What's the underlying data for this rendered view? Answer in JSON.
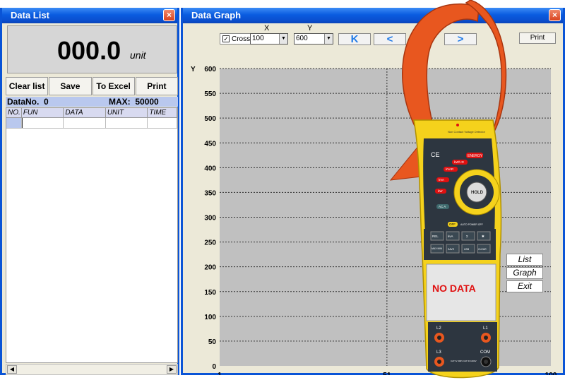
{
  "data_list": {
    "title": "Data List",
    "close_label": "×",
    "display_value": "000.0",
    "display_unit": "unit",
    "buttons": [
      "Clear list",
      "Save",
      "To Excel",
      "Print"
    ],
    "data_no_label": "DataNo.",
    "data_no_value": "0",
    "max_label": "MAX:",
    "max_value": "50000",
    "columns": [
      "NO.",
      "FUN",
      "DATA",
      "UNIT",
      "TIME"
    ]
  },
  "data_graph": {
    "title": "Data Graph",
    "close_label": "×",
    "x_label": "X",
    "y_label": "Y",
    "cross_label": "Cross",
    "cross_checked": "✓",
    "x_select": "100",
    "y_select": "600",
    "nav": [
      "K",
      "<",
      ">"
    ],
    "print_label": "Print",
    "y_axis_title": "Y",
    "x_axis_title": "X",
    "y_ticks": [
      "600",
      "550",
      "500",
      "450",
      "400",
      "350",
      "300",
      "250",
      "200",
      "150",
      "100",
      "50",
      "0"
    ],
    "x_ticks": [
      "1",
      "51",
      "100"
    ]
  },
  "side_buttons": [
    "List",
    "Graph",
    "Exit"
  ],
  "meter": {
    "screen_text": "NO DATA",
    "energy": "ENERGY",
    "modes": [
      "kWh Φ",
      "kVAR",
      "kVA",
      "kW",
      "AC A"
    ],
    "hold": "HOLD",
    "buttons_row1": [
      "REL",
      "kvA",
      "Σ",
      "✱"
    ],
    "buttons_row2": [
      "MAX MIN",
      "SAVE",
      "USB",
      "CLEAR"
    ],
    "auto_off": "AUTO POWER OFF",
    "off": "OFF",
    "jack_labels": [
      "L2",
      "L1",
      "L3",
      "COM"
    ],
    "ce": "CE",
    "ncv": "Non Contact Voltage Detector",
    "cat": "CAT IV 600V CAT III 1000V"
  },
  "colors": {
    "title_blue": "#0a5ce0",
    "plot_bg": "#c0c0c0",
    "meter_yellow": "#f5d21c",
    "meter_orange": "#e8571f",
    "no_data_red": "#e01010"
  },
  "chart_data": {
    "type": "line",
    "series": [],
    "x_ticks": [
      1,
      51,
      100
    ],
    "y_ticks": [
      0,
      50,
      100,
      150,
      200,
      250,
      300,
      350,
      400,
      450,
      500,
      550,
      600
    ],
    "xlim": [
      1,
      100
    ],
    "ylim": [
      0,
      600
    ],
    "xlabel": "X",
    "ylabel": "Y",
    "grid": true
  }
}
